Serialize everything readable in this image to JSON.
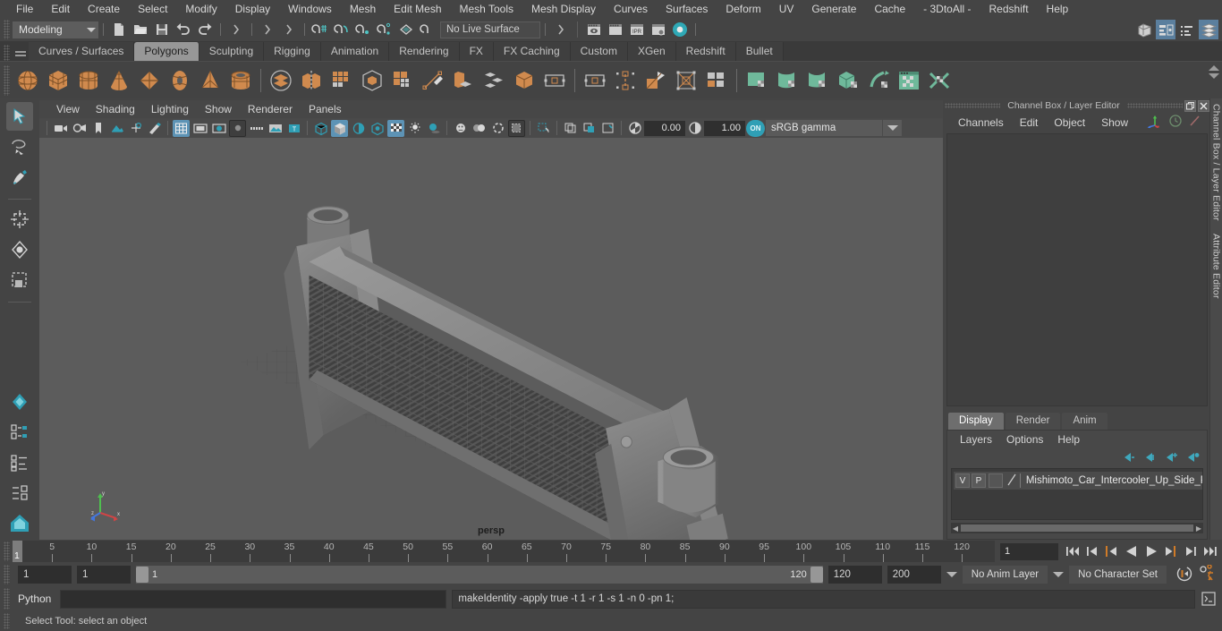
{
  "menubar": {
    "items": [
      "File",
      "Edit",
      "Create",
      "Select",
      "Modify",
      "Display",
      "Windows",
      "Mesh",
      "Edit Mesh",
      "Mesh Tools",
      "Mesh Display",
      "Curves",
      "Surfaces",
      "Deform",
      "UV",
      "Generate",
      "Cache",
      "- 3DtoAll -",
      "Redshift",
      "Help"
    ]
  },
  "statusbar": {
    "menuset": "Modeling",
    "live_surface": "No Live Surface",
    "icons": [
      "new-scene-icon",
      "open-scene-icon",
      "save-scene-icon",
      "undo-icon",
      "redo-icon",
      "select-by-hierarchy-icon",
      "select-by-object-icon",
      "select-by-component-icon",
      "snap-to-grid-icon",
      "snap-to-curve-icon",
      "snap-to-point-icon",
      "snap-to-projected-center-icon",
      "snap-to-view-plane-icon",
      "make-live-icon",
      "render-current-frame-icon",
      "render-sequence-icon",
      "ipr-render-icon",
      "render-settings-icon",
      "hypershade-icon"
    ],
    "right_icons": [
      "modeling-toolkit-icon",
      "attribute-editor-icon",
      "tool-settings-icon",
      "channel-box-icon"
    ]
  },
  "shelf": {
    "tabs": [
      "Curves / Surfaces",
      "Polygons",
      "Sculpting",
      "Rigging",
      "Animation",
      "Rendering",
      "FX",
      "FX Caching",
      "Custom",
      "XGen",
      "Redshift",
      "Bullet"
    ],
    "active_tab": "Polygons",
    "icons": [
      {
        "name": "poly-sphere-icon",
        "color": "#d08a4e"
      },
      {
        "name": "poly-cube-icon",
        "color": "#d08a4e"
      },
      {
        "name": "poly-cylinder-icon",
        "color": "#d08a4e"
      },
      {
        "name": "poly-cone-icon",
        "color": "#d08a4e"
      },
      {
        "name": "poly-plane-icon",
        "color": "#d08a4e"
      },
      {
        "name": "poly-torus-icon",
        "color": "#d08a4e"
      },
      {
        "name": "poly-pyramid-icon",
        "color": "#d08a4e"
      },
      {
        "name": "poly-pipe-icon",
        "color": "#d08a4e"
      },
      {
        "name": "sep",
        "color": ""
      },
      {
        "name": "combine-icon",
        "color": "#d08a4e"
      },
      {
        "name": "separate-icon",
        "color": "#cfcfcf"
      },
      {
        "name": "mirror-icon",
        "color": "#d08a4e"
      },
      {
        "name": "smooth-icon",
        "color": "#d08a4e"
      },
      {
        "name": "boolean-icon",
        "color": "#d08a4e"
      },
      {
        "name": "reduce-icon",
        "color": "#cfcfcf"
      },
      {
        "name": "create-polygon-tool-icon",
        "color": "#d08a4e"
      },
      {
        "name": "extrude-icon",
        "color": "#d08a4e"
      },
      {
        "name": "bevel-icon",
        "color": "#cfcfcf"
      },
      {
        "name": "bridge-icon",
        "color": "#d08a4e"
      },
      {
        "name": "append-polygon-icon",
        "color": "#cfcfcf"
      },
      {
        "name": "fill-hole-icon",
        "color": "#cfcfcf"
      },
      {
        "name": "multi-cut-icon",
        "color": "#d08a4e"
      },
      {
        "name": "connect-icon",
        "color": "#cfcfcf"
      },
      {
        "name": "quad-draw-icon",
        "color": "#d08a4e"
      },
      {
        "name": "sep2",
        "color": ""
      },
      {
        "name": "uv-planar-icon",
        "color": "#6fb99b"
      },
      {
        "name": "uv-cylindrical-icon",
        "color": "#6fb99b"
      },
      {
        "name": "uv-spherical-icon",
        "color": "#6fb99b"
      },
      {
        "name": "uv-automatic-icon",
        "color": "#6fb99b"
      },
      {
        "name": "uv-unfold-icon",
        "color": "#6fb99b"
      },
      {
        "name": "uv-editor-icon",
        "color": "#6fb99b"
      },
      {
        "name": "uv-cut-icon",
        "color": "#6fb99b"
      }
    ]
  },
  "toolbox": {
    "items": [
      "select-tool-icon",
      "lasso-select-tool-icon",
      "paint-select-tool-icon",
      "move-tool-icon",
      "rotate-tool-icon",
      "scale-tool-icon",
      "last-tool-icon",
      "snap-together-tool-icon",
      "show-manipulator-tool-icon",
      "current-layout-icon"
    ]
  },
  "viewport": {
    "menu": [
      "View",
      "Shading",
      "Lighting",
      "Show",
      "Renderer",
      "Panels"
    ],
    "camera_label": "persp",
    "exposure": "0.00",
    "gamma": "1.00",
    "color_management": "sRGB gamma",
    "toolbar_icons": [
      "select-camera-icon",
      "camera-attributes-icon",
      "bookmark-icon",
      "image-plane-icon",
      "two-d-pan-zoom-icon",
      "grease-pencil-icon",
      "grid-icon",
      "film-gate-icon",
      "resolution-gate-icon",
      "gate-mask-icon",
      "film-origin-icon",
      "safe-action-icon",
      "title-safe-icon",
      "wireframe-icon",
      "smooth-shade-icon",
      "shaded-wireframe-icon",
      "textured-icon",
      "use-default-lighting-icon",
      "shadows-icon",
      "screen-space-ao-icon",
      "motion-blur-icon",
      "multisample-aa-icon",
      "isolate-select-icon",
      "xray-icon",
      "xray-joints-icon",
      "xray-active-components-icon",
      "exposure-icon",
      "gamma-icon",
      "color-management-toggle-icon"
    ]
  },
  "channel_box": {
    "title": "Channel Box / Layer Editor",
    "menu": [
      "Channels",
      "Edit",
      "Object",
      "Show"
    ],
    "header_icons": [
      "axis-gizmo-icon",
      "clock-icon",
      "pencil-icon"
    ],
    "window_buttons": [
      "restore-icon",
      "close-icon"
    ],
    "side_tabs": [
      "Channel Box / Layer Editor",
      "Attribute Editor"
    ]
  },
  "layer_editor": {
    "tabs": [
      "Display",
      "Render",
      "Anim"
    ],
    "active_tab": "Display",
    "menu": [
      "Layers",
      "Options",
      "Help"
    ],
    "buttons": [
      "move-layer-up-icon",
      "move-layer-down-icon",
      "new-layer-icon",
      "new-layer-from-selected-icon"
    ],
    "layers": [
      {
        "visibility": "V",
        "playback": "P",
        "name": "Mishimoto_Car_Intercooler_Up_Side_Pip"
      }
    ]
  },
  "timeline": {
    "ticks": [
      5,
      10,
      15,
      20,
      25,
      30,
      35,
      40,
      45,
      50,
      55,
      60,
      65,
      70,
      75,
      80,
      85,
      90,
      95,
      100,
      105,
      110,
      115,
      120
    ],
    "current_frame": "1",
    "frame_field": "1",
    "playback_buttons": [
      "go-to-start-icon",
      "step-back-keyframe-icon",
      "step-back-frame-icon",
      "play-backwards-icon",
      "play-forwards-icon",
      "step-forward-frame-icon",
      "step-forward-keyframe-icon",
      "go-to-end-icon"
    ]
  },
  "range": {
    "anim_start": "1",
    "range_start": "1",
    "slider_start": "1",
    "slider_end": "120",
    "range_end": "120",
    "anim_end": "200",
    "anim_layer": "No Anim Layer",
    "character_set": "No Character Set",
    "right_icons": [
      "auto-keyframe-icon",
      "animation-preferences-icon"
    ]
  },
  "command_line": {
    "language": "Python",
    "input_value": "",
    "output": "makeIdentity -apply true -t 1 -r 1 -s 1 -n 0 -pn 1;",
    "script_editor_icon": "script-editor-icon"
  },
  "help_line": {
    "text": "Select Tool: select an object"
  },
  "colors": {
    "accent_blue": "#5d93b5",
    "shelf_orange": "#d08a4e",
    "shelf_green": "#6fb99b",
    "viewport_bg": "#5c5c5c",
    "model_grey": "#6e6e6e",
    "panel_bg": "#444444"
  }
}
